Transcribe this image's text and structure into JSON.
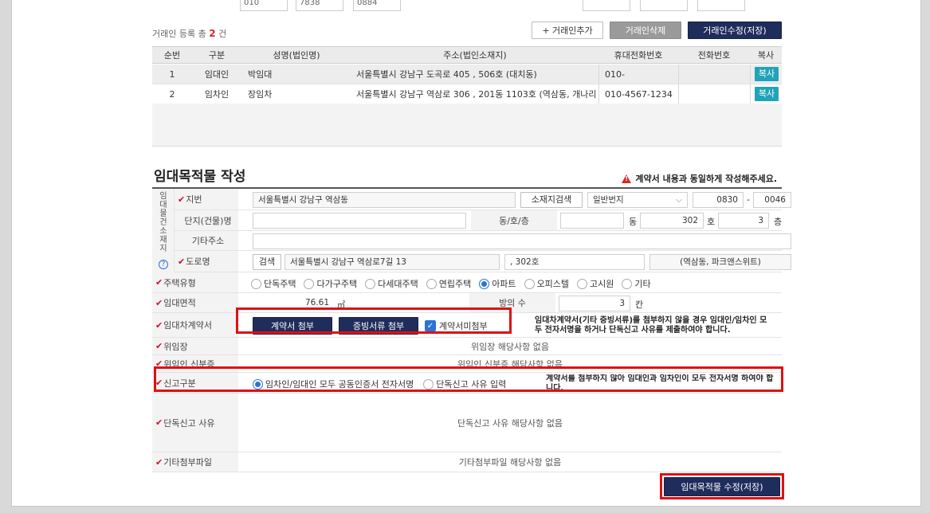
{
  "top_fields": {
    "phone_prefix": "010",
    "mid": "7838",
    "last": "0884"
  },
  "list": {
    "count_prefix": "거래인 등록 총",
    "count": "2",
    "count_suffix": "건",
    "add_label": "+ 거래인추가",
    "delete_label": "거래인삭제",
    "save_label": "거래인수정(저장)",
    "headers": [
      "순번",
      "구분",
      "성명(법인명)",
      "주소(법인소재지)",
      "휴대전화번호",
      "전화번호",
      "복사"
    ],
    "rows": [
      {
        "no": "1",
        "type": "임대인",
        "name": "박임대",
        "address": "서울특별시 강남구 도곡로 405 , 506호  (대치동)",
        "mobile": "010-",
        "phone": "",
        "copy": "복사"
      },
      {
        "no": "2",
        "type": "임차인",
        "name": "장임차",
        "address": "서울특별시 강남구 역삼로 306 , 201동 1103호  (역삼동, 개나리 래",
        "mobile": "010-4567-1234",
        "phone": "",
        "copy": "복사"
      }
    ]
  },
  "section": {
    "title": "임대목적물 작성",
    "warning": "계약서 내용과 동일하게 작성해주세요."
  },
  "location": {
    "side_label": "임대물건소재지",
    "jibun_label": "지번",
    "jibun_value": "서울특별시 강남구 역삼동",
    "search_btn": "소재지검색",
    "bunji_type": "일반번지",
    "bunji_main": "0830",
    "bunji_dash": "-",
    "bunji_sub": "0046",
    "complex_label": "단지(건물)명",
    "complex_value": "",
    "dongho_label": "동/호/층",
    "dong_unit": "동",
    "ho_value": "302",
    "ho_unit": "호",
    "floor_value": "3",
    "floor_unit": "층",
    "etc_label": "기타주소",
    "road_label": "도로명",
    "road_search": "검색",
    "road_value": "서울특별시 강남구 역삼로7길 13",
    "road_detail": ", 302호",
    "road_extra": "(역삼동, 파크앤스위트)"
  },
  "house_type": {
    "label": "주택유형",
    "options": [
      "단독주택",
      "다가구주택",
      "다세대주택",
      "연립주택",
      "아파트",
      "오피스텔",
      "고시원",
      "기타"
    ],
    "selected": "아파트"
  },
  "area": {
    "label": "임대면적",
    "value": "76.61",
    "unit": "㎡",
    "rooms_label": "방의 수",
    "rooms_value": "3",
    "rooms_unit": "칸"
  },
  "contract": {
    "label": "임대차계약서",
    "attach_btn": "계약서 첨부",
    "evidence_btn": "증빙서류 첨부",
    "no_attach": "계약서미첨부",
    "note": "임대차계약서(기타 증빙서류)를 첨부하지 않을 경우 임대인/임차인 모두 전자서명을 하거나 단독신고 사유를 제출하여야 합니다."
  },
  "proxy": {
    "label": "위임장",
    "value": "위임장 해당사항 없음"
  },
  "proxy_id": {
    "label": "위임인 신분증",
    "value": "위임인 신분증 해당사항 없음"
  },
  "report": {
    "label": "신고구분",
    "opt1": "임차인/임대인 모두 공동인증서 전자서명",
    "opt2": "단독신고 사유 입력",
    "note": "계약서를 첨부하지 않아 임대인과 임차인이 모두 전자서명 하여야 합니다."
  },
  "single": {
    "label": "단독신고 사유",
    "value": "단독신고 사유 해당사항 없음"
  },
  "extra": {
    "label": "기타첨부파일",
    "value": "기타첨부파일 해당사항 없음"
  },
  "submit_label": "임대목적물 수정(저장)",
  "colors": {
    "navy": "#1f2d5c",
    "teal": "#21a3b8",
    "highlight_red": "#e01010",
    "required_mark": "#c8102e",
    "radio_blue": "#2a73d9"
  }
}
